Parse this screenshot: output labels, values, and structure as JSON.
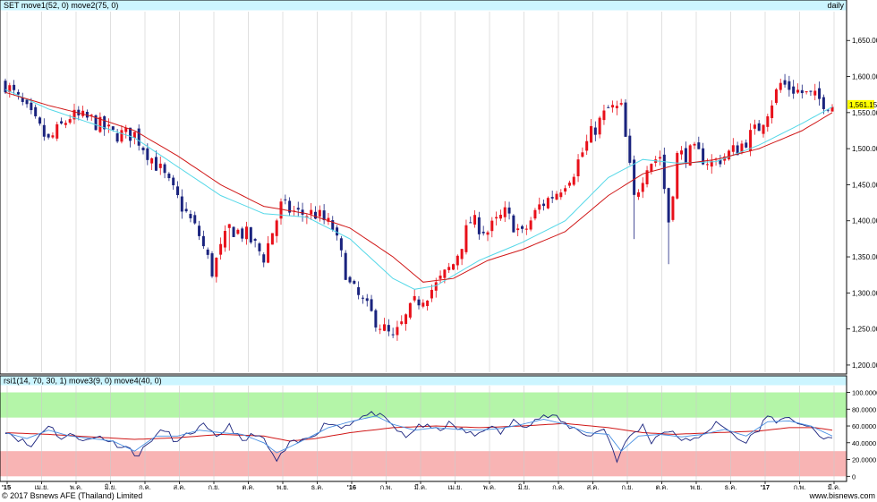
{
  "header": {
    "left": "SET move1(52, 0) move2(75, 0)",
    "right": "daily"
  },
  "indicator_header": "rsi1(14, 70, 30, 1) move3(9, 0) move4(40, 0)",
  "footer": {
    "copyright": "© 2017 Bsnews AFE (Thailand) Limited",
    "site": "www.bisnews.com"
  },
  "colors": {
    "header_bg": "#ccf5ff",
    "up_candle": "#e8101a",
    "down_candle": "#1a237e",
    "ma52": "#55d8e8",
    "ma75": "#d01818",
    "rsi_line": "#1a237e",
    "rsi_ma_short": "#4a90e2",
    "rsi_ma_long": "#d01818",
    "overbought_zone": "#b4f5a8",
    "oversold_zone": "#f8b4b4",
    "grid": "#cccccc"
  },
  "current_price_label": "1,561.15",
  "chart_data": [
    {
      "type": "candlestick",
      "title": "SET",
      "ylim": [
        1190,
        1690
      ],
      "yticks": [
        1200,
        1250,
        1300,
        1350,
        1400,
        1450,
        1500,
        1550,
        1600,
        1650
      ],
      "ytick_labels": [
        "1,200.00",
        "1,250.00",
        "1,300.00",
        "1,350.00",
        "1,400.00",
        "1,450.00",
        "1,500.00",
        "1,550.00",
        "1,600.00",
        "1,650.00"
      ],
      "last_close": 1561.15,
      "close_keypoints": [
        [
          0,
          1590
        ],
        [
          4,
          1560
        ],
        [
          10,
          1510
        ],
        [
          15,
          1545
        ],
        [
          20,
          1540
        ],
        [
          25,
          1520
        ],
        [
          30,
          1520
        ],
        [
          36,
          1470
        ],
        [
          40,
          1430
        ],
        [
          45,
          1380
        ],
        [
          48,
          1330
        ],
        [
          52,
          1390
        ],
        [
          56,
          1380
        ],
        [
          60,
          1350
        ],
        [
          64,
          1420
        ],
        [
          68,
          1410
        ],
        [
          72,
          1410
        ],
        [
          76,
          1390
        ],
        [
          80,
          1310
        ],
        [
          85,
          1270
        ],
        [
          90,
          1235
        ],
        [
          95,
          1285
        ],
        [
          100,
          1310
        ],
        [
          104,
          1340
        ],
        [
          108,
          1400
        ],
        [
          112,
          1385
        ],
        [
          116,
          1410
        ],
        [
          120,
          1380
        ],
        [
          124,
          1420
        ],
        [
          128,
          1440
        ],
        [
          132,
          1470
        ],
        [
          136,
          1520
        ],
        [
          140,
          1555
        ],
        [
          143,
          1555
        ],
        [
          146,
          1430
        ],
        [
          149,
          1480
        ],
        [
          152,
          1490
        ],
        [
          154,
          1400
        ],
        [
          156,
          1490
        ],
        [
          160,
          1495
        ],
        [
          164,
          1480
        ],
        [
          170,
          1500
        ],
        [
          175,
          1530
        ],
        [
          180,
          1590
        ],
        [
          184,
          1580
        ],
        [
          188,
          1570
        ],
        [
          192,
          1561
        ]
      ],
      "series": [
        {
          "name": "move1(52, 0)",
          "keypoints": [
            [
              0,
              1582
            ],
            [
              10,
              1555
            ],
            [
              20,
              1535
            ],
            [
              30,
              1515
            ],
            [
              40,
              1475
            ],
            [
              50,
              1435
            ],
            [
              60,
              1410
            ],
            [
              70,
              1405
            ],
            [
              80,
              1375
            ],
            [
              90,
              1320
            ],
            [
              95,
              1305
            ],
            [
              100,
              1310
            ],
            [
              110,
              1345
            ],
            [
              120,
              1370
            ],
            [
              130,
              1400
            ],
            [
              140,
              1460
            ],
            [
              148,
              1485
            ],
            [
              156,
              1480
            ],
            [
              165,
              1482
            ],
            [
              175,
              1505
            ],
            [
              185,
              1535
            ],
            [
              192,
              1558
            ]
          ]
        },
        {
          "name": "move2(75, 0)",
          "keypoints": [
            [
              0,
              1578
            ],
            [
              10,
              1560
            ],
            [
              20,
              1545
            ],
            [
              30,
              1525
            ],
            [
              40,
              1490
            ],
            [
              50,
              1450
            ],
            [
              60,
              1420
            ],
            [
              70,
              1410
            ],
            [
              80,
              1390
            ],
            [
              90,
              1350
            ],
            [
              97,
              1315
            ],
            [
              104,
              1320
            ],
            [
              112,
              1345
            ],
            [
              120,
              1360
            ],
            [
              130,
              1385
            ],
            [
              140,
              1435
            ],
            [
              148,
              1465
            ],
            [
              156,
              1478
            ],
            [
              165,
              1485
            ],
            [
              175,
              1500
            ],
            [
              185,
              1525
            ],
            [
              192,
              1550
            ]
          ]
        }
      ]
    },
    {
      "type": "line",
      "title": "rsi1(14, 70, 30, 1)",
      "ylim": [
        -5,
        108
      ],
      "overbought": 70,
      "oversold": 30,
      "yticks": [
        0,
        20,
        40,
        60,
        80,
        100
      ],
      "ytick_labels": [
        "0",
        "20.0000",
        "40.0000",
        "60.0000",
        "80.0000",
        "100.0000"
      ],
      "x_tick_labels": [
        "'15",
        "เม.ย.",
        "พ.ค.",
        "มิ.ย.",
        "ก.ค.",
        "ส.ค.",
        "ก.ย.",
        "ต.ค.",
        "พ.ย.",
        "ธ.ค.",
        "'16",
        "ก.พ.",
        "มี.ค.",
        "เม.ย.",
        "พ.ค.",
        "มิ.ย.",
        "ก.ค.",
        "ส.ค.",
        "ก.ย.",
        "ต.ค.",
        "พ.ย.",
        "ธ.ค.",
        "'17",
        "ก.พ.",
        "มี.ค."
      ],
      "rsi_keypoints": [
        [
          0,
          55
        ],
        [
          3,
          45
        ],
        [
          6,
          35
        ],
        [
          8,
          50
        ],
        [
          10,
          62
        ],
        [
          13,
          45
        ],
        [
          16,
          50
        ],
        [
          19,
          42
        ],
        [
          22,
          48
        ],
        [
          25,
          40
        ],
        [
          28,
          35
        ],
        [
          31,
          25
        ],
        [
          34,
          45
        ],
        [
          37,
          55
        ],
        [
          40,
          40
        ],
        [
          43,
          52
        ],
        [
          46,
          60
        ],
        [
          49,
          45
        ],
        [
          52,
          62
        ],
        [
          55,
          40
        ],
        [
          58,
          52
        ],
        [
          60,
          42
        ],
        [
          63,
          18
        ],
        [
          66,
          38
        ],
        [
          69,
          42
        ],
        [
          72,
          52
        ],
        [
          75,
          65
        ],
        [
          78,
          58
        ],
        [
          82,
          70
        ],
        [
          86,
          75
        ],
        [
          90,
          60
        ],
        [
          93,
          45
        ],
        [
          96,
          62
        ],
        [
          100,
          55
        ],
        [
          103,
          62
        ],
        [
          106,
          55
        ],
        [
          109,
          48
        ],
        [
          112,
          60
        ],
        [
          115,
          52
        ],
        [
          118,
          65
        ],
        [
          121,
          62
        ],
        [
          124,
          70
        ],
        [
          127,
          72
        ],
        [
          130,
          62
        ],
        [
          133,
          55
        ],
        [
          136,
          48
        ],
        [
          139,
          58
        ],
        [
          142,
          20
        ],
        [
          145,
          48
        ],
        [
          148,
          60
        ],
        [
          150,
          42
        ],
        [
          153,
          55
        ],
        [
          156,
          48
        ],
        [
          159,
          40
        ],
        [
          162,
          52
        ],
        [
          165,
          62
        ],
        [
          168,
          55
        ],
        [
          171,
          40
        ],
        [
          174,
          50
        ],
        [
          177,
          72
        ],
        [
          180,
          65
        ],
        [
          183,
          68
        ],
        [
          186,
          60
        ],
        [
          189,
          48
        ],
        [
          192,
          45
        ]
      ],
      "series": [
        {
          "name": "move3(9, 0)",
          "keypoints": [
            [
              0,
              52
            ],
            [
              5,
              45
            ],
            [
              10,
              55
            ],
            [
              15,
              48
            ],
            [
              20,
              45
            ],
            [
              25,
              42
            ],
            [
              30,
              30
            ],
            [
              35,
              48
            ],
            [
              40,
              48
            ],
            [
              45,
              55
            ],
            [
              50,
              52
            ],
            [
              55,
              50
            ],
            [
              60,
              40
            ],
            [
              63,
              28
            ],
            [
              66,
              35
            ],
            [
              70,
              45
            ],
            [
              75,
              58
            ],
            [
              80,
              65
            ],
            [
              86,
              72
            ],
            [
              90,
              62
            ],
            [
              95,
              55
            ],
            [
              100,
              58
            ],
            [
              105,
              56
            ],
            [
              110,
              55
            ],
            [
              115,
              57
            ],
            [
              120,
              62
            ],
            [
              125,
              68
            ],
            [
              130,
              62
            ],
            [
              135,
              52
            ],
            [
              140,
              50
            ],
            [
              143,
              30
            ],
            [
              147,
              48
            ],
            [
              152,
              50
            ],
            [
              157,
              47
            ],
            [
              162,
              50
            ],
            [
              167,
              56
            ],
            [
              172,
              48
            ],
            [
              177,
              65
            ],
            [
              182,
              66
            ],
            [
              187,
              60
            ],
            [
              192,
              48
            ]
          ]
        },
        {
          "name": "move4(40, 0)",
          "keypoints": [
            [
              0,
              52
            ],
            [
              10,
              50
            ],
            [
              20,
              47
            ],
            [
              30,
              44
            ],
            [
              40,
              46
            ],
            [
              50,
              50
            ],
            [
              60,
              48
            ],
            [
              66,
              42
            ],
            [
              72,
              45
            ],
            [
              80,
              52
            ],
            [
              90,
              58
            ],
            [
              100,
              60
            ],
            [
              110,
              58
            ],
            [
              120,
              60
            ],
            [
              130,
              63
            ],
            [
              140,
              58
            ],
            [
              148,
              52
            ],
            [
              155,
              50
            ],
            [
              165,
              52
            ],
            [
              175,
              54
            ],
            [
              182,
              58
            ],
            [
              188,
              58
            ],
            [
              192,
              55
            ]
          ]
        }
      ]
    }
  ]
}
